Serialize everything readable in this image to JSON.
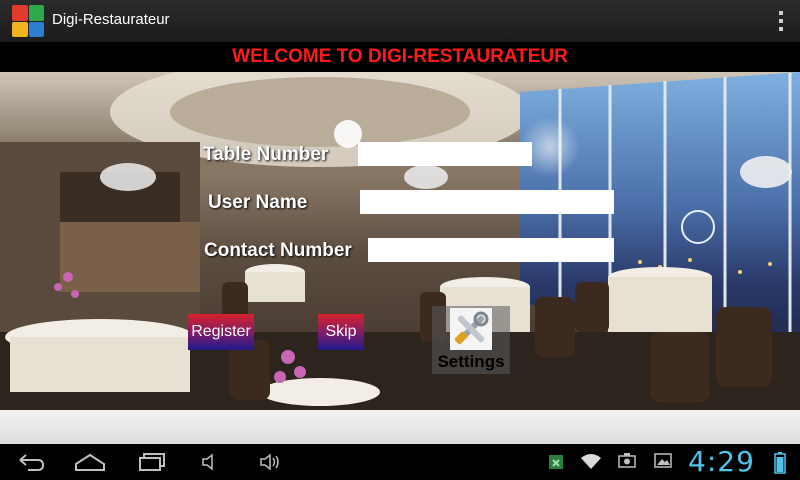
{
  "app": {
    "title": "Digi-Restaurateur"
  },
  "banner": {
    "text": "WELCOME TO DIGI-RESTAURATEUR"
  },
  "form": {
    "table_number_label": "Table Number",
    "user_name_label": "User Name",
    "contact_number_label": "Contact Number",
    "table_number_value": "",
    "user_name_value": "",
    "contact_number_value": ""
  },
  "buttons": {
    "register": "Register",
    "skip": "Skip",
    "settings": "Settings"
  },
  "statusbar": {
    "time": "4:29"
  },
  "colors": {
    "banner_text": "#ff1a1a",
    "clock": "#4fc3ea",
    "button_top": "#d8222a",
    "button_bottom": "#1f1a8c"
  },
  "icons": [
    "app-logo-icon",
    "overflow-menu-icon",
    "tools-icon",
    "back-icon",
    "home-icon",
    "recent-apps-icon",
    "volume-down-icon",
    "volume-up-icon",
    "store-icon",
    "wifi-icon",
    "camera-icon",
    "gallery-icon",
    "battery-icon"
  ]
}
